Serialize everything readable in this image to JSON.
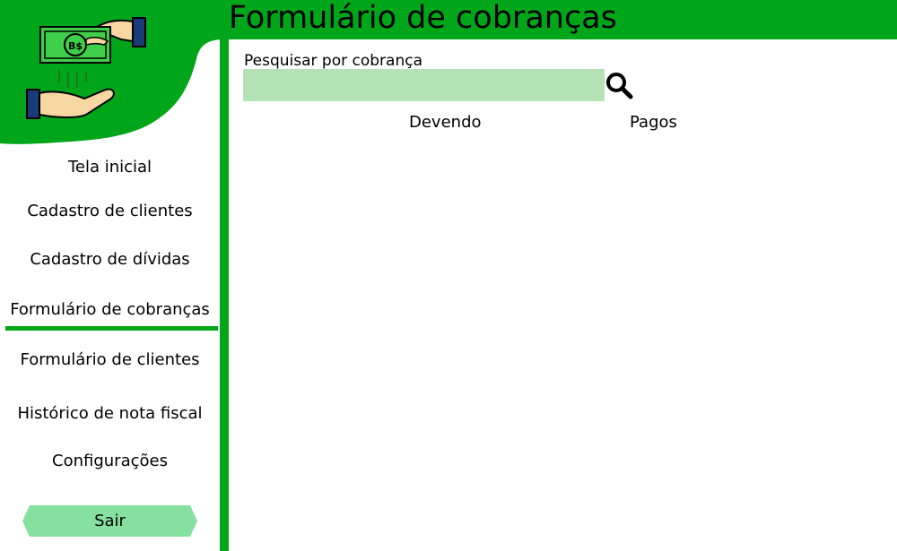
{
  "header": {
    "title": "Formulário de cobranças"
  },
  "logo": {
    "currency_symbol": "B$",
    "icon": "money-exchange-hands-icon"
  },
  "colors": {
    "brand_green": "#00a619",
    "input_bg": "#b3e2b4",
    "button_bg": "#86e09f"
  },
  "sidebar": {
    "items": [
      {
        "label": "Tela inicial"
      },
      {
        "label": "Cadastro de clientes"
      },
      {
        "label": "Cadastro de dívidas"
      },
      {
        "label": "Formulário de cobranças",
        "active": true
      },
      {
        "label": "Formulário de clientes"
      },
      {
        "label": "Histórico de nota fiscal"
      },
      {
        "label": "Configurações"
      }
    ],
    "logout_label": "Sair"
  },
  "main": {
    "search": {
      "label": "Pesquisar por cobrança",
      "value": "",
      "placeholder": ""
    },
    "tabs": [
      {
        "label": "Devendo"
      },
      {
        "label": "Pagos"
      }
    ]
  }
}
